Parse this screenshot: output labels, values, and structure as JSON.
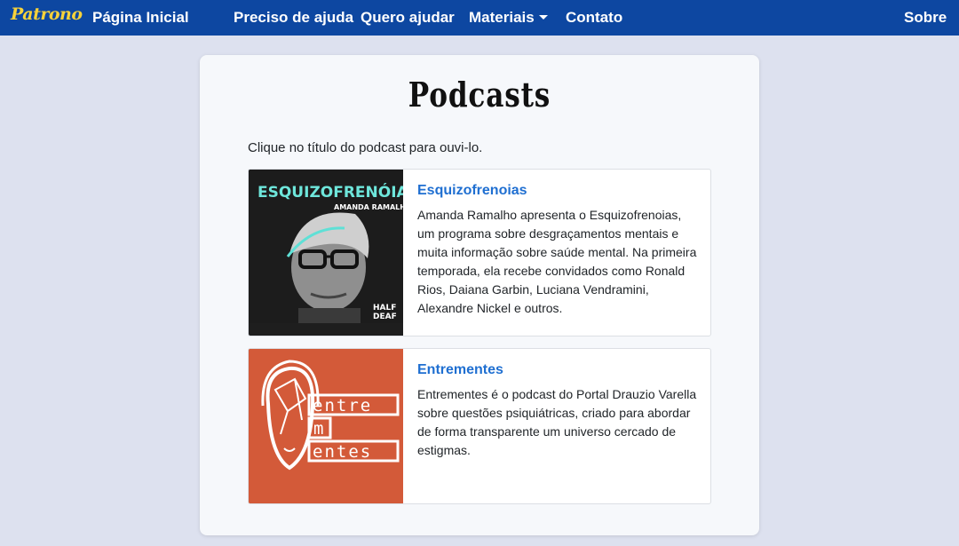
{
  "navbar": {
    "brand": "Patrono",
    "links": [
      "Página Inicial",
      "Preciso de ajuda",
      "Quero ajudar",
      "Materiais",
      "Contato"
    ],
    "right_link": "Sobre",
    "background": "#0d47a1",
    "brand_color": "#f7d23a"
  },
  "page": {
    "title": "Podcasts",
    "intro": "Clique no título do podcast para ouvi-lo."
  },
  "podcasts": [
    {
      "title": "Esquizofrenoias",
      "description": "Amanda Ramalho apresenta o Esquizofrenoias, um programa sobre desgraçamentos mentais e muita informação sobre saúde mental. Na primeira temporada, ela recebe convidados como Ronald Rios, Daiana Garbin, Luciana Vendramini, Alexandre Nickel e outros.",
      "cover": {
        "title": "ESQUIZOFRENÓIAS",
        "subtitle": "AMANDA RAMALHO",
        "badge_1": "HALF",
        "badge_2": "DEAF"
      }
    },
    {
      "title": "Entrementes",
      "description": "Entrementes é o podcast do Portal Drauzio Varella sobre questões psiquiátricas, criado para abordar de forma transparente um universo cercado de estigmas.",
      "cover": {
        "line_1": "entre",
        "line_2": "m",
        "line_3": "entes"
      }
    }
  ],
  "colors": {
    "page_bg": "#dde1ef",
    "card_bg": "#f6f8fb",
    "link": "#1f6fd1",
    "cover_2_bg": "#d35a39"
  }
}
